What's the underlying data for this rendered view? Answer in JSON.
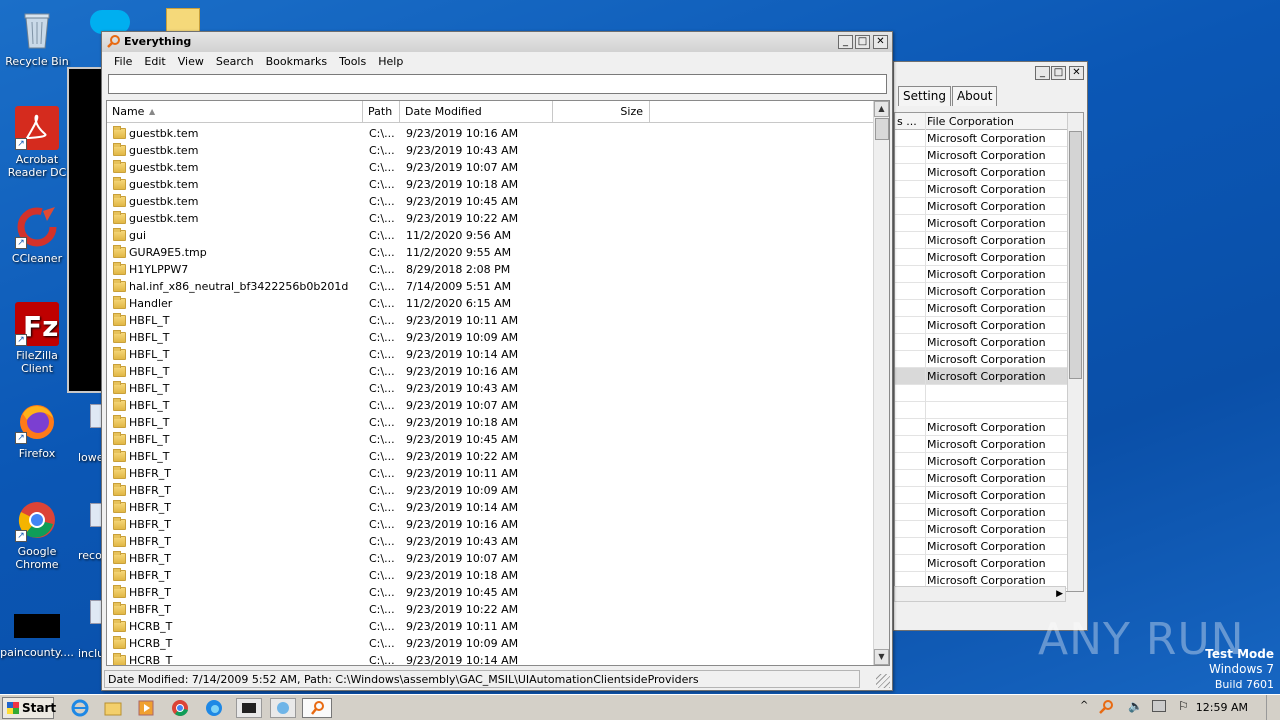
{
  "desktop": {
    "icons": [
      {
        "label": "Recycle Bin"
      },
      {
        "label": "Acrobat Reader DC"
      },
      {
        "label": "CCleaner"
      },
      {
        "label": "FileZilla Client"
      },
      {
        "label": "Firefox"
      },
      {
        "label": "Google Chrome"
      },
      {
        "label": "paincounty...."
      }
    ],
    "partial_labels": [
      "lowe",
      "reco",
      "inclu"
    ],
    "watermark": {
      "brand": "ANY RUN",
      "mode": "Test Mode",
      "os": "Windows 7",
      "build": "Build 7601"
    }
  },
  "everything": {
    "title": "Everything",
    "menu": [
      "File",
      "Edit",
      "View",
      "Search",
      "Bookmarks",
      "Tools",
      "Help"
    ],
    "search_value": "",
    "columns": {
      "name": "Name",
      "path": "Path",
      "date": "Date Modified",
      "size": "Size"
    },
    "rows": [
      {
        "name": "guestbk.tem",
        "path": "C:\\...",
        "date": "9/23/2019 10:16 AM"
      },
      {
        "name": "guestbk.tem",
        "path": "C:\\...",
        "date": "9/23/2019 10:43 AM"
      },
      {
        "name": "guestbk.tem",
        "path": "C:\\...",
        "date": "9/23/2019 10:07 AM"
      },
      {
        "name": "guestbk.tem",
        "path": "C:\\...",
        "date": "9/23/2019 10:18 AM"
      },
      {
        "name": "guestbk.tem",
        "path": "C:\\...",
        "date": "9/23/2019 10:45 AM"
      },
      {
        "name": "guestbk.tem",
        "path": "C:\\...",
        "date": "9/23/2019 10:22 AM"
      },
      {
        "name": "gui",
        "path": "C:\\...",
        "date": "11/2/2020 9:56 AM"
      },
      {
        "name": "GURA9E5.tmp",
        "path": "C:\\...",
        "date": "11/2/2020 9:55 AM"
      },
      {
        "name": "H1YLPPW7",
        "path": "C:\\...",
        "date": "8/29/2018 2:08 PM"
      },
      {
        "name": "hal.inf_x86_neutral_bf3422256b0b201d",
        "path": "C:\\...",
        "date": "7/14/2009 5:51 AM"
      },
      {
        "name": "Handler",
        "path": "C:\\...",
        "date": "11/2/2020 6:15 AM"
      },
      {
        "name": "HBFL_T",
        "path": "C:\\...",
        "date": "9/23/2019 10:11 AM"
      },
      {
        "name": "HBFL_T",
        "path": "C:\\...",
        "date": "9/23/2019 10:09 AM"
      },
      {
        "name": "HBFL_T",
        "path": "C:\\...",
        "date": "9/23/2019 10:14 AM"
      },
      {
        "name": "HBFL_T",
        "path": "C:\\...",
        "date": "9/23/2019 10:16 AM"
      },
      {
        "name": "HBFL_T",
        "path": "C:\\...",
        "date": "9/23/2019 10:43 AM"
      },
      {
        "name": "HBFL_T",
        "path": "C:\\...",
        "date": "9/23/2019 10:07 AM"
      },
      {
        "name": "HBFL_T",
        "path": "C:\\...",
        "date": "9/23/2019 10:18 AM"
      },
      {
        "name": "HBFL_T",
        "path": "C:\\...",
        "date": "9/23/2019 10:45 AM"
      },
      {
        "name": "HBFL_T",
        "path": "C:\\...",
        "date": "9/23/2019 10:22 AM"
      },
      {
        "name": "HBFR_T",
        "path": "C:\\...",
        "date": "9/23/2019 10:11 AM"
      },
      {
        "name": "HBFR_T",
        "path": "C:\\...",
        "date": "9/23/2019 10:09 AM"
      },
      {
        "name": "HBFR_T",
        "path": "C:\\...",
        "date": "9/23/2019 10:14 AM"
      },
      {
        "name": "HBFR_T",
        "path": "C:\\...",
        "date": "9/23/2019 10:16 AM"
      },
      {
        "name": "HBFR_T",
        "path": "C:\\...",
        "date": "9/23/2019 10:43 AM"
      },
      {
        "name": "HBFR_T",
        "path": "C:\\...",
        "date": "9/23/2019 10:07 AM"
      },
      {
        "name": "HBFR_T",
        "path": "C:\\...",
        "date": "9/23/2019 10:18 AM"
      },
      {
        "name": "HBFR_T",
        "path": "C:\\...",
        "date": "9/23/2019 10:45 AM"
      },
      {
        "name": "HBFR_T",
        "path": "C:\\...",
        "date": "9/23/2019 10:22 AM"
      },
      {
        "name": "HCRB_T",
        "path": "C:\\...",
        "date": "9/23/2019 10:11 AM"
      },
      {
        "name": "HCRB_T",
        "path": "C:\\...",
        "date": "9/23/2019 10:09 AM"
      },
      {
        "name": "HCRB_T",
        "path": "C:\\...",
        "date": "9/23/2019 10:14 AM"
      }
    ],
    "status": "Date Modified: 7/14/2009 5:52 AM, Path: C:\\Windows\\assembly\\GAC_MSIL\\UIAutomationClientsideProviders"
  },
  "bgwindow": {
    "tabs": [
      "Setting",
      "About"
    ],
    "col_left": "s ...",
    "col_right": "File Corporation",
    "rows": [
      "Microsoft Corporation",
      "Microsoft Corporation",
      "Microsoft Corporation",
      "Microsoft Corporation",
      "Microsoft Corporation",
      "Microsoft Corporation",
      "Microsoft Corporation",
      "Microsoft Corporation",
      "Microsoft Corporation",
      "Microsoft Corporation",
      "Microsoft Corporation",
      "Microsoft Corporation",
      "Microsoft Corporation",
      "Microsoft Corporation",
      "Microsoft Corporation",
      "",
      "",
      "Microsoft Corporation",
      "Microsoft Corporation",
      "Microsoft Corporation",
      "Microsoft Corporation",
      "Microsoft Corporation",
      "Microsoft Corporation",
      "Microsoft Corporation",
      "Microsoft Corporation",
      "Microsoft Corporation",
      "Microsoft Corporation"
    ]
  },
  "taskbar": {
    "start": "Start",
    "time": "12:59 AM"
  },
  "colors": {
    "desktop": "#0b57b5",
    "selected_row": "#d9d9d9"
  }
}
